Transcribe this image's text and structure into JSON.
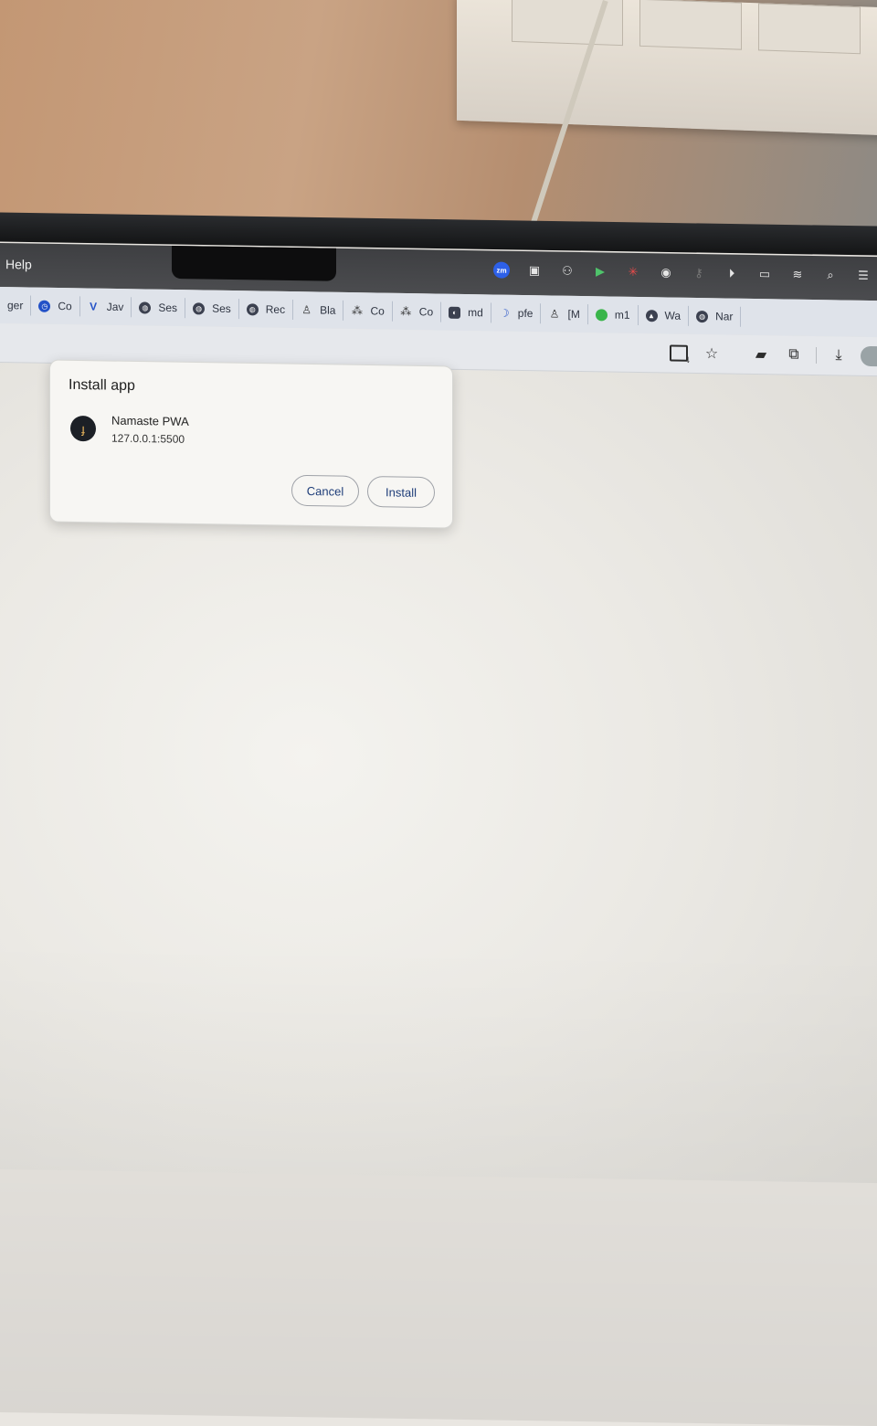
{
  "menubar": {
    "help_label": "Help",
    "status_icons": [
      "zoom-icon",
      "outlook-icon",
      "teams-icon",
      "screen-share-icon",
      "pinwheel-icon",
      "vpn-icon",
      "key-icon",
      "play-icon",
      "battery-icon",
      "wifi-icon",
      "spotlight-search-icon",
      "control-center-icon"
    ],
    "zoom_badge": "zm"
  },
  "bookmarks": [
    {
      "label": "ger",
      "icon": "none"
    },
    {
      "label": "Co",
      "icon": "clock-icon"
    },
    {
      "label": "Jav",
      "icon": "v-logo-icon"
    },
    {
      "label": "Ses",
      "icon": "globe-icon"
    },
    {
      "label": "Ses",
      "icon": "globe-icon"
    },
    {
      "label": "Rec",
      "icon": "globe-icon"
    },
    {
      "label": "Bla",
      "icon": "person-icon"
    },
    {
      "label": "Co",
      "icon": "nodes-icon"
    },
    {
      "label": "Co",
      "icon": "nodes-icon"
    },
    {
      "label": "md",
      "icon": "github-icon"
    },
    {
      "label": "pfe",
      "icon": "moon-icon"
    },
    {
      "label": "[M",
      "icon": "person-icon"
    },
    {
      "label": "m1",
      "icon": "green-dot-icon"
    },
    {
      "label": "Wa",
      "icon": "triangle-icon"
    },
    {
      "label": "Nar",
      "icon": "globe-icon"
    }
  ],
  "toolbar": {
    "icons": [
      "install-app-icon",
      "star-icon",
      "extension-square-icon",
      "puzzle-icon",
      "download-icon"
    ]
  },
  "dialog": {
    "title": "Install app",
    "app_name": "Namaste PWA",
    "app_origin": "127.0.0.1:5500",
    "cancel_label": "Cancel",
    "install_label": "Install",
    "app_icon_glyph": "ɟ"
  },
  "colors": {
    "button_text": "#1d3c78",
    "zoom_badge": "#2d60e8",
    "app_icon_bg": "#1c2026"
  }
}
